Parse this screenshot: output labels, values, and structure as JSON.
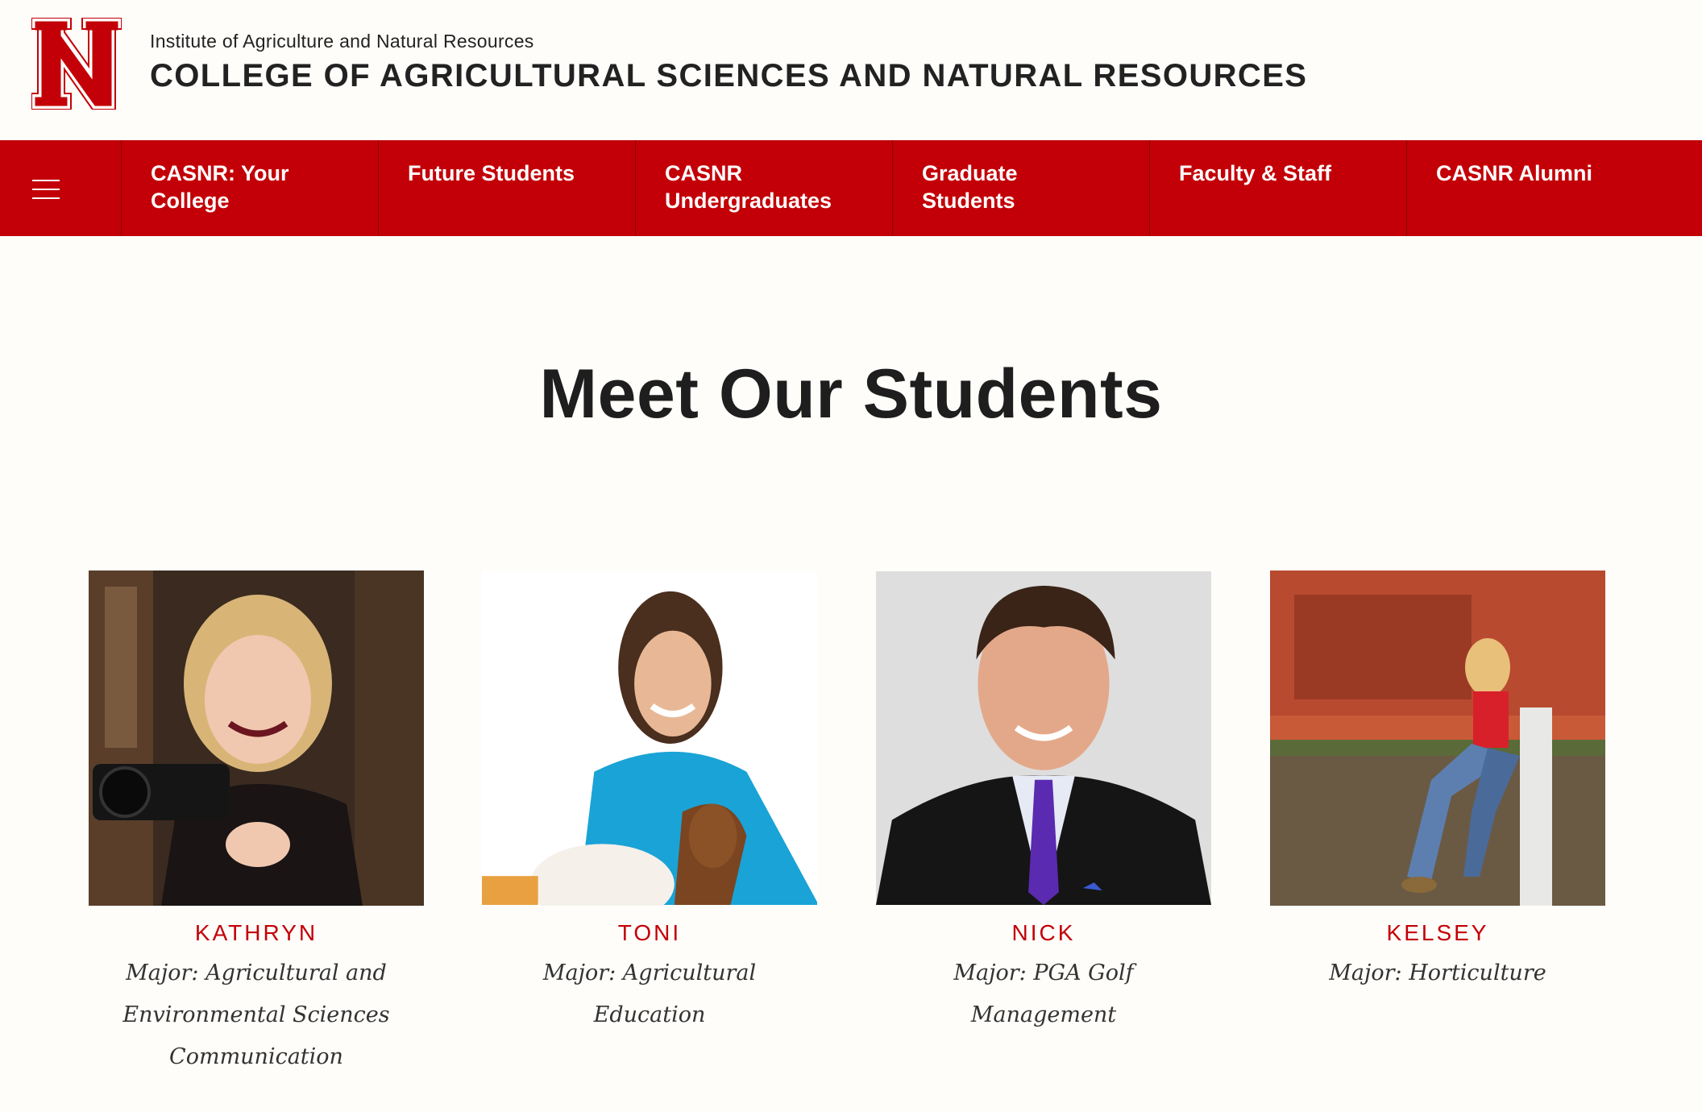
{
  "header": {
    "institute": "Institute of Agriculture and Natural Resources",
    "college": "COLLEGE OF AGRICULTURAL SCIENCES AND NATURAL RESOURCES",
    "logo_letter": "N",
    "brand_color": "#c30007"
  },
  "nav": {
    "menu_icon": "hamburger-menu-icon",
    "items": [
      {
        "label": "CASNR: Your\nCollege"
      },
      {
        "label": "Future Students"
      },
      {
        "label": "CASNR\nUndergraduates"
      },
      {
        "label": "Graduate\nStudents"
      },
      {
        "label": "Faculty & Staff"
      },
      {
        "label": "CASNR Alumni"
      }
    ]
  },
  "main": {
    "title": "Meet Our Students",
    "students": [
      {
        "name": "KATHRYN",
        "major": "Major:  Agricultural and Environmental Sciences Communication"
      },
      {
        "name": "TONI",
        "major": "Major:  Agricultural Education"
      },
      {
        "name": "NICK",
        "major": "Major:  PGA Golf Management"
      },
      {
        "name": "KELSEY",
        "major": "Major:  Horticulture"
      }
    ]
  }
}
